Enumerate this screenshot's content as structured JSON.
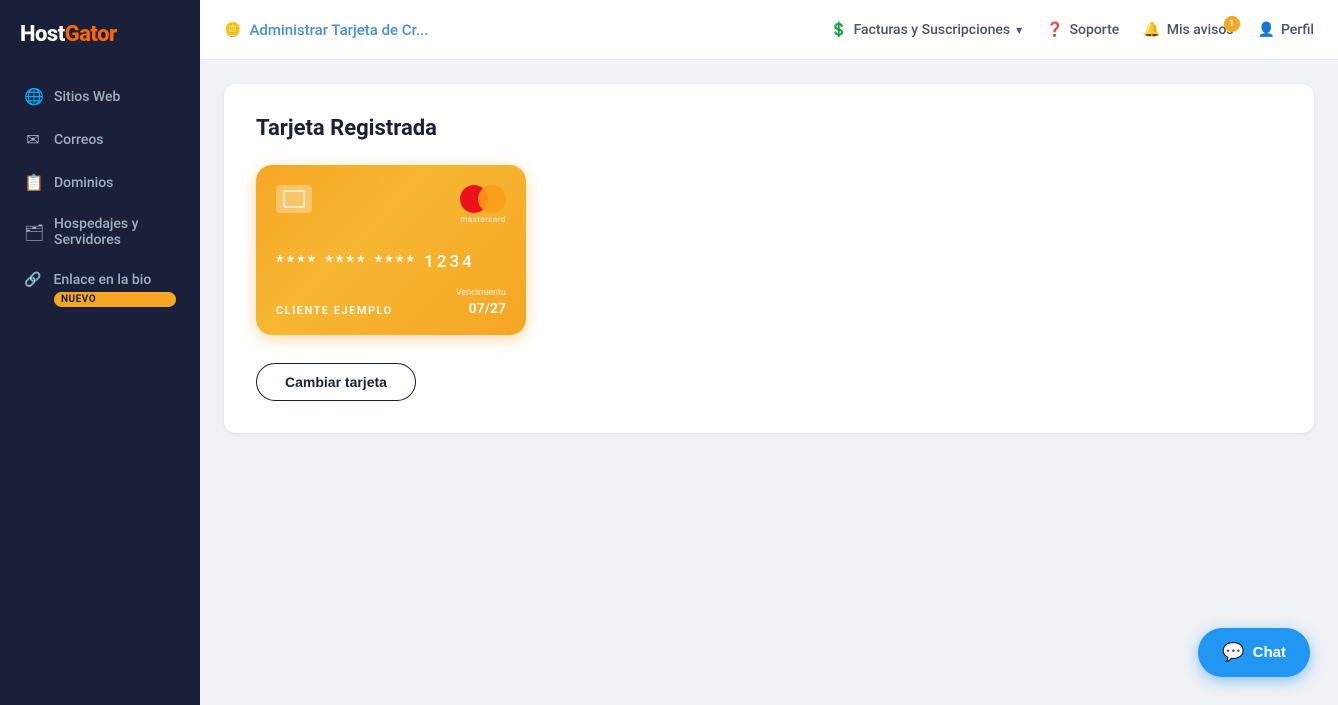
{
  "sidebar": {
    "logo": "HostGator",
    "items": [
      {
        "id": "sitios-web",
        "label": "Sitios Web",
        "icon": "🌐"
      },
      {
        "id": "correos",
        "label": "Correos",
        "icon": "✉"
      },
      {
        "id": "dominios",
        "label": "Dominios",
        "icon": "📋"
      },
      {
        "id": "hospedajes",
        "label": "Hospedajes y Servidores",
        "icon": "🗂"
      },
      {
        "id": "enlace-bio",
        "label": "Enlace en la bio",
        "icon": "🔗",
        "badge": "NUEVO"
      }
    ]
  },
  "header": {
    "title": "Administrar Tarjeta de Cr...",
    "nav": [
      {
        "id": "facturas",
        "label": "Facturas y Suscripciones",
        "has_dropdown": true,
        "icon": "💲"
      },
      {
        "id": "soporte",
        "label": "Soporte",
        "icon": "❓"
      },
      {
        "id": "avisos",
        "label": "Mis avisos",
        "icon": "🔔",
        "badge": "1"
      },
      {
        "id": "perfil",
        "label": "Perfil",
        "icon": "👤"
      }
    ]
  },
  "main": {
    "card_section": {
      "title": "Tarjeta Registrada",
      "credit_card": {
        "number": "**** **** **** 1234",
        "holder": "CLIENTE EJEMPLO",
        "expiry_label": "Vencimiento",
        "expiry_value": "07/27"
      },
      "change_button_label": "Cambiar tarjeta"
    }
  },
  "chat_button": {
    "label": "Chat"
  }
}
